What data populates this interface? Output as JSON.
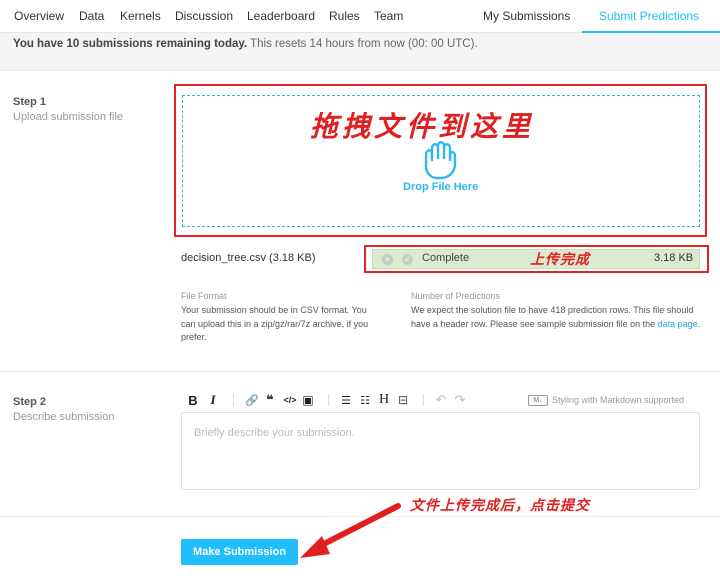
{
  "nav": {
    "items": [
      "Overview",
      "Data",
      "Kernels",
      "Discussion",
      "Leaderboard",
      "Rules",
      "Team"
    ],
    "my_submissions": "My Submissions",
    "submit_predictions": "Submit Predictions"
  },
  "banner": {
    "bold": "You have 10 submissions remaining today.",
    "rest": " This resets 14 hours from now (00: 00 UTC)."
  },
  "step1": {
    "title": "Step 1",
    "subtitle": "Upload submission file",
    "drop_annotation": "拖拽文件到这里",
    "drop_text": "Drop File Here"
  },
  "upload": {
    "file_name": "decision_tree.csv (3.18 KB)",
    "status": "Complete",
    "status_annotation": "上传完成",
    "size": "3.18 KB",
    "progress": 1.0
  },
  "file_format": {
    "label": "File Format",
    "text": "Your submission should be in CSV format. You can upload this in a zip/gz/rar/7z archive, if you prefer."
  },
  "num_predictions": {
    "label": "Number of Predictions",
    "text": "We expect the solution file to have 418 prediction rows. This file should have a header row. Please see sample submission file on the ",
    "link": "data page",
    "end": "."
  },
  "step2": {
    "title": "Step 2",
    "subtitle": "Describe submission",
    "placeholder": "Briefly describe your submission.",
    "markdown_badge": "M↓",
    "markdown_note": "Styling with Markdown supported"
  },
  "toolbar": {
    "bold": "B",
    "italic": "I",
    "link": "🔗",
    "quote": "❝",
    "code": "</>",
    "image": "▣",
    "ordered_list": "☰",
    "bullet_list": "☷",
    "heading": "H",
    "hr": "⊟",
    "undo": "↶",
    "redo": "↷"
  },
  "submit": {
    "label": "Make Submission",
    "annotation": "文件上传完成后，点击提交"
  },
  "colors": {
    "accent": "#20beff",
    "annotation_red": "#e02020",
    "complete_green": "#dbead0"
  }
}
